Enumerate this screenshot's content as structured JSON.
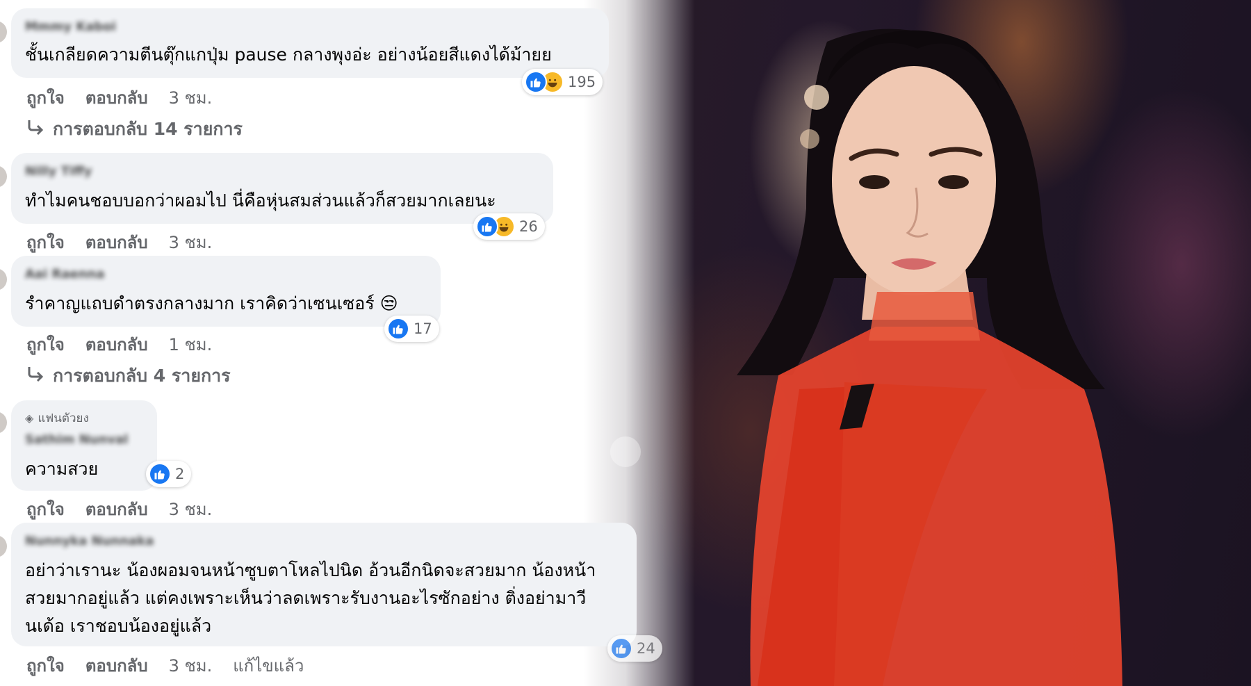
{
  "colors": {
    "bubble": "#f0f2f5",
    "like_blue": "#1877f2",
    "haha_yellow": "#f7b928",
    "secondary_text": "#65676b",
    "dress_red": "#e8442e"
  },
  "icons": {
    "like": "like-icon",
    "haha": "haha-icon",
    "diamond": "diamond-icon",
    "reply_arrow": "reply-arrow-icon"
  },
  "comments": [
    {
      "author": "Mmmy Kaboi",
      "text_lines": [
        "ชั้นเกลียดความตีนตุ๊กแกปุ่ม pause กลางพุงอ่ะ อย่างน้อยสีแดงได้ม้ายย"
      ],
      "reaction_count": "195",
      "actions": {
        "like": "ถูกใจ",
        "reply": "ตอบกลับ",
        "time": "3 ชม."
      },
      "replies_label": "การตอบกลับ 14 รายการ"
    },
    {
      "author": "Nilly Tiffy",
      "text_lines": [
        "ทำไมคนชอบบอกว่าผอมไป นี่คือหุ่นสมส่วนแล้วก็สวยมากเลยนะ"
      ],
      "reaction_count": "26",
      "actions": {
        "like": "ถูกใจ",
        "reply": "ตอบกลับ",
        "time": "3 ชม."
      }
    },
    {
      "author": "Aai Raenna",
      "text_lines": [
        "รำคาญแถบดำตรงกลางมาก เราคิดว่าเซนเซอร์ 😒"
      ],
      "reaction_count": "17",
      "actions": {
        "like": "ถูกใจ",
        "reply": "ตอบกลับ",
        "time": "1 ชม."
      },
      "replies_label": "การตอบกลับ 4 รายการ"
    },
    {
      "badge": "แฟนตัวยง",
      "author": "Sathim Nunval",
      "text_lines": [
        "ความสวย"
      ],
      "reaction_count": "2",
      "actions": {
        "like": "ถูกใจ",
        "reply": "ตอบกลับ",
        "time": "3 ชม."
      }
    },
    {
      "author": "Nunnyka Nunnaka",
      "text_lines": [
        "อย่าว่าเรานะ น้องผอมจนหน้าซูบตาโหลไปนิด อ้วนอีกนิดจะสวยมาก น้องหน้า",
        "สวยมากอยู่แล้ว แต่คงเพราะเห็นว่าลดเพราะรับงานอะไรซักอย่าง ติ่งอย่ามาวี",
        "นเด้อ เราชอบน้องอยู่แล้ว"
      ],
      "reaction_count": "24",
      "actions": {
        "like": "ถูกใจ",
        "reply": "ตอบกลับ",
        "time": "3 ชม.",
        "edited": "แก้ไขแล้ว"
      }
    }
  ]
}
